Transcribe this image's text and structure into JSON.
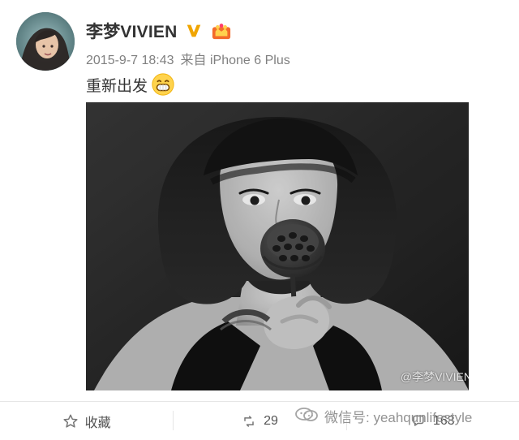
{
  "post": {
    "username": "李梦VIVIEN",
    "timestamp": "2015-9-7 18:43",
    "source": "来自 iPhone 6 Plus",
    "text": "重新出发",
    "icons": {
      "verified": "verified-v-icon",
      "crown": "crown-icon",
      "emoji": "grinning-face-icon"
    },
    "photo": {
      "watermark": "@李梦VIVIEN"
    }
  },
  "actions": {
    "favorite": {
      "label": "收藏",
      "icon": "star-outline-icon"
    },
    "repost": {
      "label": "29",
      "icon": "repost-icon"
    },
    "comment": {
      "label": "163",
      "icon": "comment-icon"
    }
  },
  "overlay": {
    "wechat": "微信号: yeahqunlifestyle",
    "icon": "wechat-icon"
  },
  "colors": {
    "accent": "#f0a500",
    "text": "#333333",
    "muted": "#808080",
    "divider": "#e6e6e6"
  }
}
